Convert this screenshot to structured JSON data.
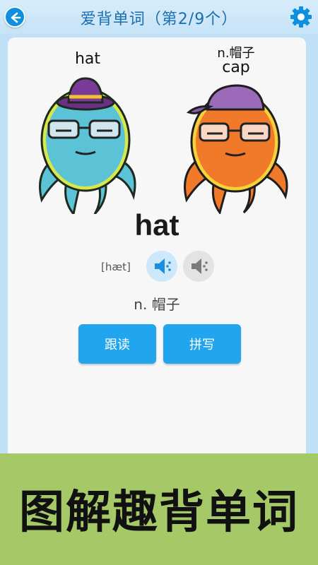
{
  "header": {
    "title": "爱背单词（第2/9个）",
    "back_icon": "back-arrow-icon",
    "settings_icon": "gear-icon",
    "accent": "#0f8fe0"
  },
  "images": {
    "left": {
      "label": "hat",
      "alt": "octopus wearing a hat"
    },
    "right": {
      "label_top": "n.帽子",
      "label_bottom": "cap",
      "alt": "octopus wearing a cap"
    }
  },
  "word": {
    "text": "hat",
    "phonetic": "[hæt]",
    "meaning": "n. 帽子",
    "speaker_icons": [
      "speaker-icon",
      "speaker-slow-icon"
    ]
  },
  "actions": {
    "read_label": "跟读",
    "spell_label": "拼写",
    "button_color": "#21a5ee"
  },
  "banner": {
    "text": "图解趣背单词",
    "color": "#a6c968"
  }
}
